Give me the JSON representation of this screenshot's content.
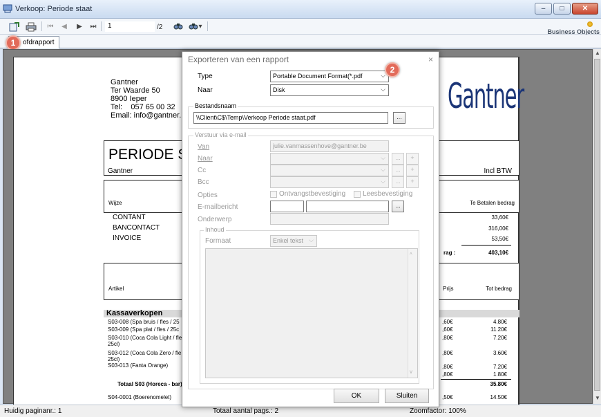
{
  "window": {
    "title": "Verkoop: Periode staat",
    "buttons": {
      "minimize": "–",
      "maximize": "□",
      "close": "✕"
    }
  },
  "toolbar": {
    "current_page": "1",
    "page_count": "/2",
    "brand": "Business Objects",
    "icons": [
      "export-icon",
      "print-icon",
      "first-page-icon",
      "prev-page-icon",
      "next-page-icon",
      "last-page-icon",
      "search-icon",
      "search-options-icon"
    ],
    "glyphs": {
      "first": "⏮",
      "prev": "◀",
      "next": "▶",
      "last": "⏭",
      "search": "🔍",
      "dropdown": "▾"
    }
  },
  "tabs": [
    {
      "label": "Hoofdrapport"
    }
  ],
  "tab_visible_label": "ofdrapport",
  "badges": {
    "one": "1",
    "two": "2"
  },
  "report": {
    "company": {
      "name": "Gantner",
      "street": "Ter Waarde 50",
      "city": "8900 Ieper",
      "tel_label": "Tel:",
      "tel": "057 65 00 32",
      "email_label": "Email:",
      "email": "info@gantner.b"
    },
    "logo_text": "Gantner",
    "title": "PERIODE S",
    "subtitle": "Gantner",
    "incl_btw": "Incl BTW",
    "payment_header_left": "Wijze",
    "payment_header_right": "Te Betalen bedrag",
    "payments": [
      {
        "name": "CONTANT",
        "amount": "33,60€"
      },
      {
        "name": "BANCONTACT",
        "amount": "316,00€"
      },
      {
        "name": "INVOICE",
        "amount": "53,50€"
      }
    ],
    "total_label": "rag :",
    "total_amount": "403,10€",
    "articles_header_left": "Artikel",
    "articles_header_price": "Prijs",
    "articles_header_total": "Tot bedrag",
    "section_title": "Kassaverkopen",
    "items": [
      {
        "name": "S03-008 (Spa bruis / fles / 25",
        "price": ",60€",
        "total": "4.80€"
      },
      {
        "name": "S03-009 (Spa plat / fles / 25c",
        "price": ",60€",
        "total": "11.20€"
      },
      {
        "name": "S03-010 (Coca Cola Light / fle",
        "name2": "25cl)",
        "price": ",80€",
        "total": "7.20€"
      },
      {
        "name": "S03-012 (Coca Cola Zero / fle",
        "name2": "25cl)",
        "price": ",80€",
        "total": "3.60€"
      },
      {
        "name": "S03-013 (Fanta Orange)",
        "price": ",80€",
        "price2": ",80€",
        "total": "7.20€",
        "total2": "1.80€"
      }
    ],
    "subtotal_label": "Totaal S03 (Horeca - bar)",
    "subtotal_amount": "35.80€",
    "last_item": {
      "name": "S04-0001 (Boerenomelet)",
      "price": ",50€",
      "total": "14.50€"
    }
  },
  "status": {
    "page_label": "Huidig paginanr.: 1",
    "total_pages": "Totaal aantal pags.: 2",
    "zoom": "Zoomfactor: 100%"
  },
  "dialog": {
    "title": "Exporteren van een rapport",
    "close": "×",
    "type_label": "Type",
    "type_value": "Portable Document Format(*.pdf",
    "naar_label": "Naar",
    "naar_value": "Disk",
    "bestandsnaam_label": "Bestandsnaam",
    "bestandsnaam_value": "\\\\Client\\C$\\Temp\\Verkoop Periode staat.pdf",
    "browse": "...",
    "email_group": "Verstuur via e-mail",
    "van_label": "Van",
    "van_value": "julie.vanmassenhove@gantner.be",
    "naar2_label": "Naar",
    "cc_label": "Cc",
    "bcc_label": "Bcc",
    "plus": "+",
    "opties_label": "Opties",
    "opt_ontvangst": "Ontvangstbevestiging",
    "opt_lees": "Leesbevestiging",
    "emailbericht_label": "E-mailbericht",
    "onderwerp_label": "Onderwerp",
    "inhoud_group": "Inhoud",
    "formaat_label": "Formaat",
    "formaat_value": "Enkel tekst",
    "ok": "OK",
    "cancel": "Sluiten"
  }
}
